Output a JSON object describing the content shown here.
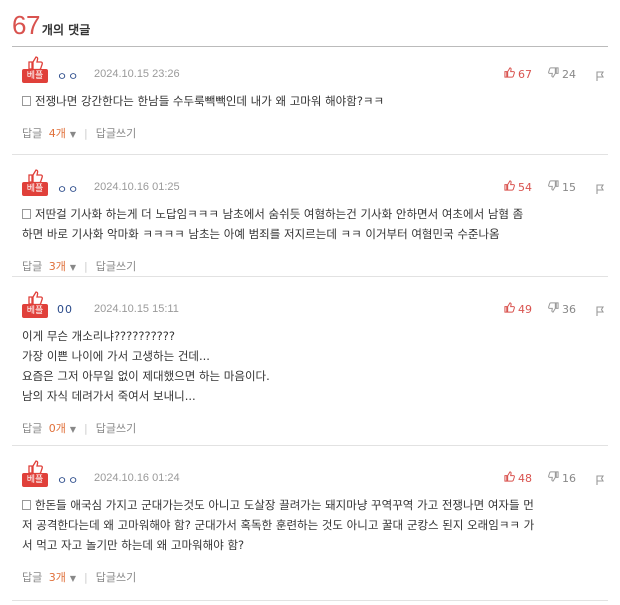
{
  "header": {
    "count": "67",
    "label": "개의 댓글"
  },
  "badge_label": "베플",
  "reply_label": "답글",
  "reply_unit": "개",
  "write_reply_label": "답글쓰기",
  "comments": [
    {
      "author": "ㅇㅇ",
      "date": "2024.10.15 23:26",
      "likes": "67",
      "dislikes": "24",
      "lines": [
        "전쟁나면 강간한다는 한남들 수두룩빽빽인데 내가 왜 고마워 해야함?ㅋㅋ"
      ],
      "replies": "4"
    },
    {
      "author": "ㅇㅇ",
      "date": "2024.10.16 01:25",
      "likes": "54",
      "dislikes": "15",
      "lines": [
        "저딴걸 기사화 하는게 더 노답임ㅋㅋㅋ 남초에서 숨쉬듯 여혐하는건 기사화 안하면서 여초에서 남혐 좀",
        "하면 바로 기사화 악마화 ㅋㅋㅋㅋ 남초는 아예 범죄를 저지르는데 ㅋㅋ 이거부터 여혐민국 수준나옴"
      ],
      "replies": "3"
    },
    {
      "author": "00",
      "date": "2024.10.15 15:11",
      "likes": "49",
      "dislikes": "36",
      "lines": [
        "이게 무슨 개소리냐??????????",
        "가장 이쁜 나이에 가서 고생하는 건데...",
        "요즘은 그저 아무일 없이 제대했으면 하는 마음이다.",
        "남의 자식 데려가서 죽여서 보내니..."
      ],
      "replies": "0"
    },
    {
      "author": "ㅇㅇ",
      "date": "2024.10.16 01:24",
      "likes": "48",
      "dislikes": "16",
      "lines": [
        "한돈들 애국심 가지고 군대가는것도 아니고 도살장 끌려가는 돼지마냥 꾸역꾸역 가고 전쟁나면 여자들 먼",
        "저 공격한다는데 왜 고마워해야 함? 군대가서 혹독한 훈련하는 것도 아니고 꿀대 군캉스 된지 오래임ㅋㅋ 가",
        "서 먹고 자고 놀기만 하는데 왜 고마워해야 함?"
      ],
      "replies": "3"
    }
  ]
}
